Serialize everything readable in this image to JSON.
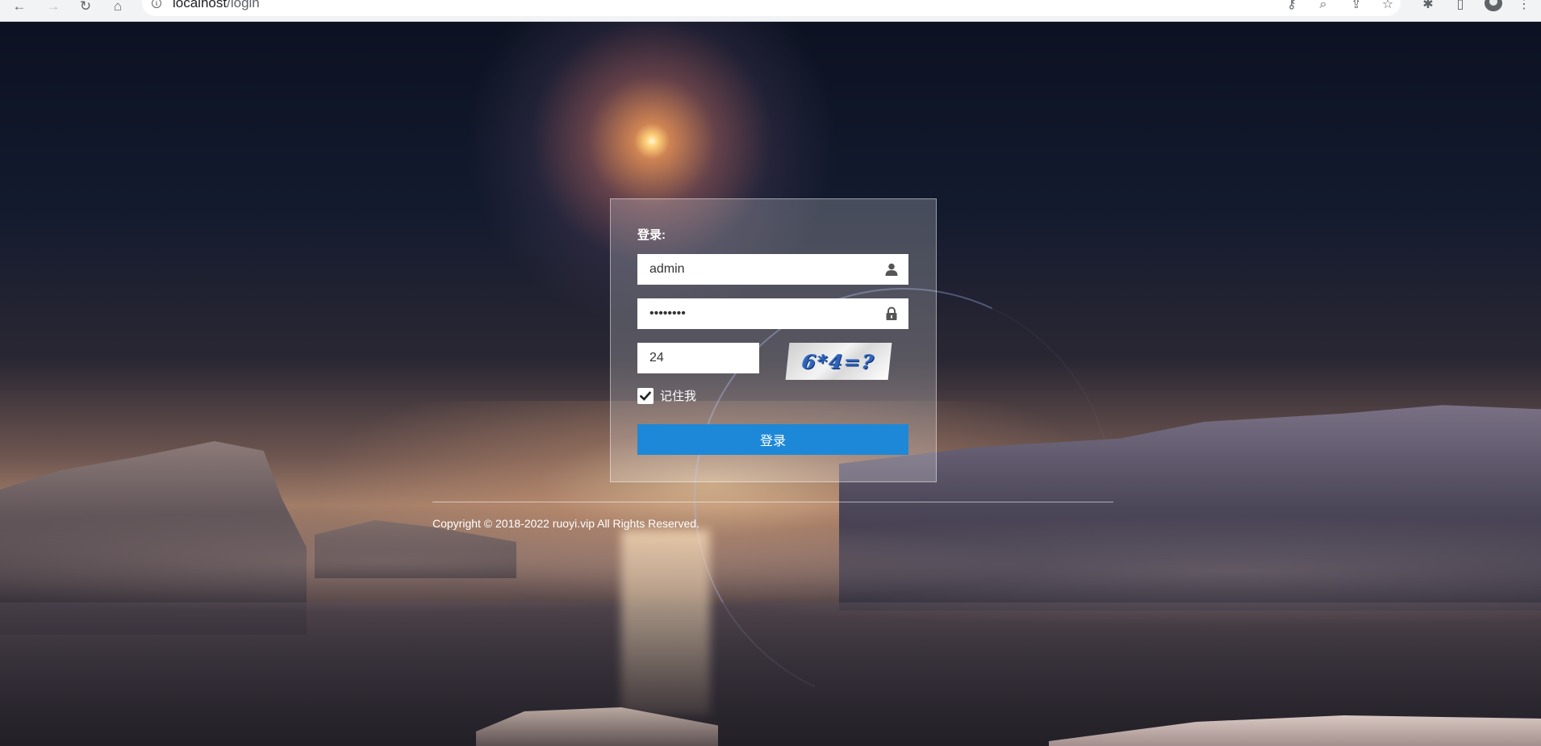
{
  "browser": {
    "url_host": "localhost",
    "url_path": "/login",
    "icons": [
      "back-arrow-icon",
      "forward-arrow-icon",
      "reload-icon",
      "home-icon",
      "info-icon",
      "key-icon",
      "zoom-icon",
      "share-icon",
      "star-icon",
      "extensions-icon",
      "side-panel-icon",
      "profile-icon",
      "menu-icon"
    ]
  },
  "login": {
    "title": "登录:",
    "username_value": "admin",
    "password_value": "••••••••",
    "captcha_value": "24",
    "captcha_image_text": "6*4=?",
    "remember_label": "记住我",
    "remember_checked": true,
    "submit_label": "登录"
  },
  "footer": {
    "copyright": "Copyright © 2018-2022 ruoyi.vip All Rights Reserved."
  },
  "colors": {
    "primary_button": "#1e88d8",
    "card_background": "rgba(255,255,255,0.22)",
    "text_light": "#ffffff"
  }
}
